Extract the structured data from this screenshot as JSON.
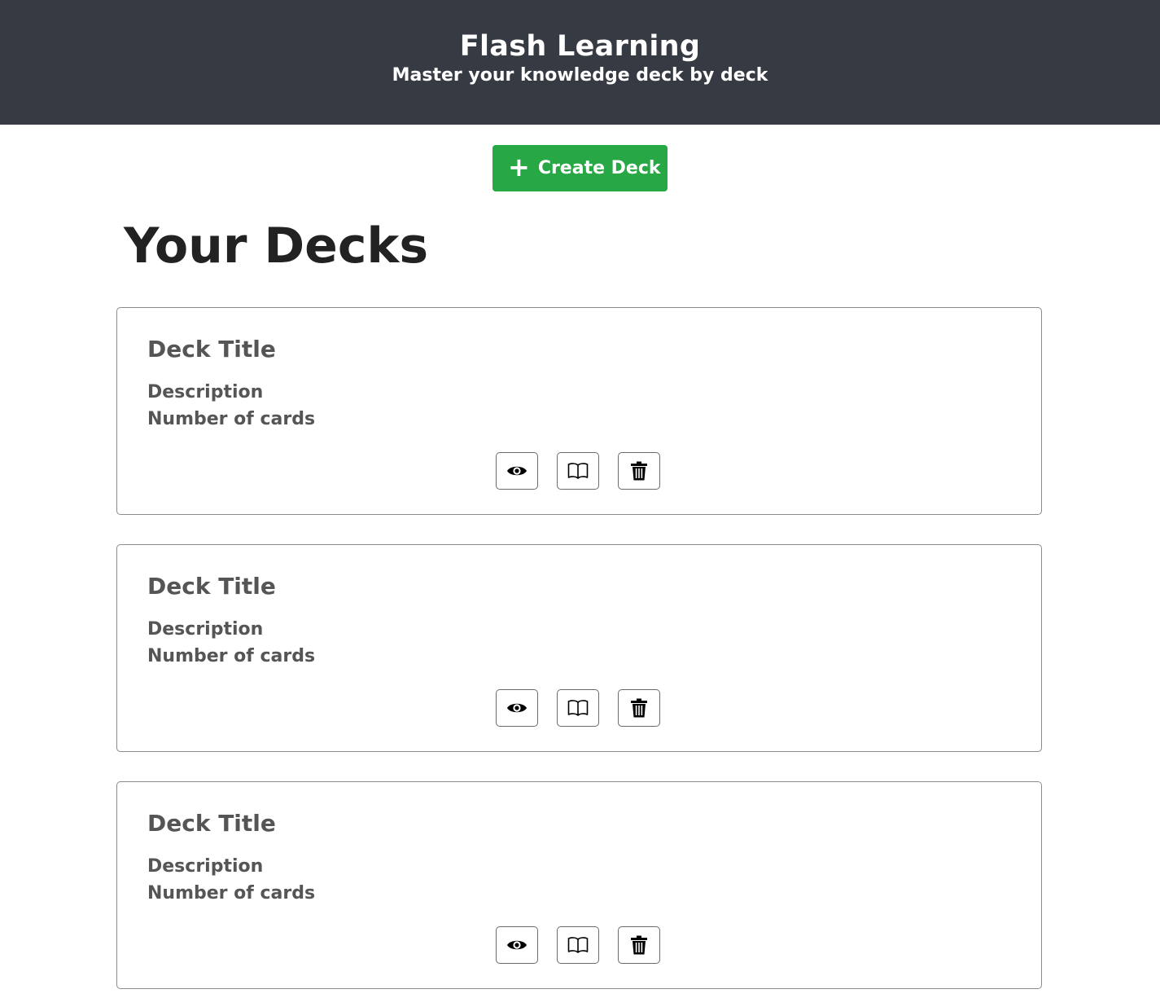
{
  "header": {
    "title": "Flash Learning",
    "subtitle": "Master your knowledge deck by deck"
  },
  "toolbar": {
    "create_label": "Create Deck",
    "create_icon": "plus-icon",
    "create_color": "#28a745"
  },
  "main": {
    "heading": "Your Decks",
    "decks": [
      {
        "title": "Deck Title",
        "description": "Description",
        "count": "Number of cards"
      },
      {
        "title": "Deck Title",
        "description": "Description",
        "count": "Number of cards"
      },
      {
        "title": "Deck Title",
        "description": "Description",
        "count": "Number of cards"
      }
    ],
    "actions": [
      {
        "name": "view",
        "icon": "eye-icon"
      },
      {
        "name": "study",
        "icon": "book-icon"
      },
      {
        "name": "delete",
        "icon": "trash-icon"
      }
    ]
  },
  "colors": {
    "header_bg": "#363a43",
    "accent": "#28a745"
  }
}
